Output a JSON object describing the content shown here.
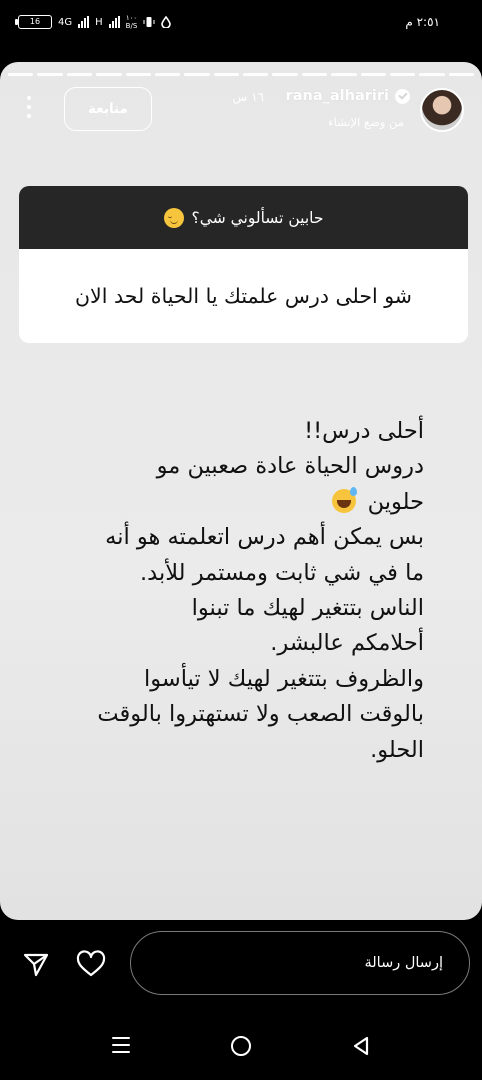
{
  "status_bar": {
    "time": "٢:٥١ م",
    "battery": "16",
    "network": "4G",
    "network2": "H",
    "speed_value": "١٠٠",
    "speed_unit": "B/S"
  },
  "story": {
    "username": "rana_alhariri",
    "time_ago": "١٦ س",
    "subtitle": "من وضع الإنشاء",
    "follow_label": "متابعة",
    "question_title": "حابين تسألوني شي؟",
    "question_text": "شو احلى درس علمتك يا الحياة لحد الان",
    "body_lines": [
      "أحلى درس!!",
      "دروس الحياة عادة صعبين مو",
      "حلوين",
      "بس يمكن أهم درس اتعلمته هو أنه",
      "ما في شي ثابت ومستمر للأبد.",
      "الناس بتتغير لهيك ما تبنوا",
      "أحلامكم عالبشر.",
      "والظروف بتتغير لهيك لا تيأسوا",
      "بالوقت الصعب ولا تستهتروا بالوقت",
      "الحلو."
    ],
    "progress_segments": 16
  },
  "reply": {
    "placeholder": "إرسال رسالة"
  },
  "icons": {
    "send": "send-icon",
    "like": "heart-icon",
    "more": "more-options-icon",
    "nav_recents": "recents-icon",
    "nav_home": "home-icon",
    "nav_back": "back-icon"
  }
}
